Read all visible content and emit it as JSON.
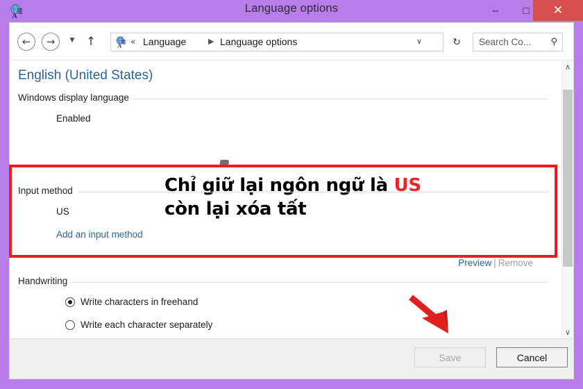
{
  "window": {
    "title": "Language options",
    "app_icon": "language-globe-icon",
    "controls": {
      "minimize": "–",
      "maximize": "□",
      "close": "✕"
    },
    "frame_color": "#b97de9",
    "close_color": "#d8504c"
  },
  "addressbar": {
    "back_icon": "←",
    "forward_icon": "→",
    "recent_icon": "▼",
    "up_icon": "↑",
    "crumb_icon": "language-globe-icon",
    "leading_chevrons": "«",
    "crumb_1": "Language",
    "crumb_separator": "▶",
    "crumb_2": "Language options",
    "dropdown_caret": "∨",
    "refresh_icon": "↻",
    "search_placeholder": "Search Co...",
    "search_icon": "⚲"
  },
  "content": {
    "page_heading": "English (United States)",
    "groups": [
      {
        "label": "Windows display language",
        "value": "Enabled"
      },
      {
        "label": "Input method",
        "value": "US",
        "link": "Add an input method",
        "preview": "Preview",
        "divider": "|",
        "remove": "Remove"
      },
      {
        "label": "Handwriting",
        "options": [
          {
            "label": "Write characters in freehand",
            "checked": true
          },
          {
            "label": "Write each character separately",
            "checked": false
          }
        ]
      }
    ]
  },
  "scrollbar": {
    "up_arrow": "∧",
    "down_arrow": "∨"
  },
  "footer": {
    "save_label": "Save",
    "save_enabled": false,
    "cancel_label": "Cancel"
  },
  "annotations": {
    "highlight_color": "#ed1c24",
    "line1_prefix": "Chỉ giữ lại ngôn ngữ là ",
    "line1_highlight": "US",
    "line2": "còn lại xóa tất",
    "arrow": "red-arrow-pointing-to-save"
  }
}
